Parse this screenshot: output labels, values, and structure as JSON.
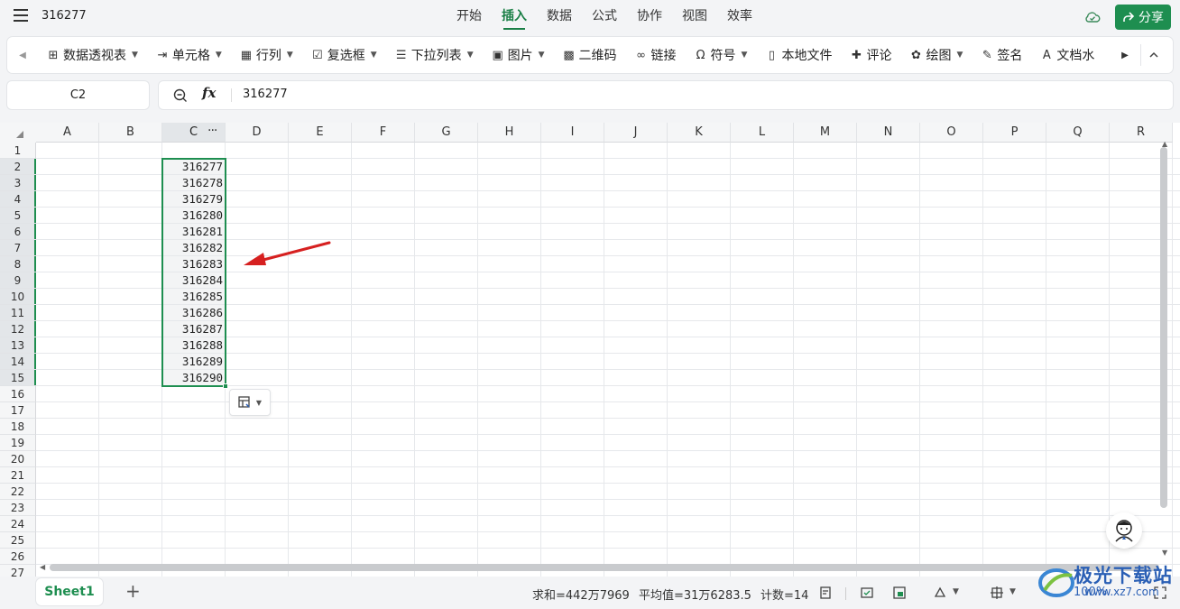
{
  "title_bar": {
    "doc_title": "316277",
    "tabs": [
      {
        "label": "开始",
        "active": false
      },
      {
        "label": "插入",
        "active": true
      },
      {
        "label": "数据",
        "active": false
      },
      {
        "label": "公式",
        "active": false
      },
      {
        "label": "协作",
        "active": false
      },
      {
        "label": "视图",
        "active": false
      },
      {
        "label": "效率",
        "active": false
      }
    ],
    "share_label": "分享"
  },
  "ribbon": {
    "items": [
      {
        "label": "数据透视表",
        "icon": "pivot-table-icon",
        "dropdown": true
      },
      {
        "label": "单元格",
        "icon": "cell-icon",
        "dropdown": true
      },
      {
        "label": "行列",
        "icon": "row-col-icon",
        "dropdown": true
      },
      {
        "label": "复选框",
        "icon": "checkbox-icon",
        "dropdown": true
      },
      {
        "label": "下拉列表",
        "icon": "dropdown-list-icon",
        "dropdown": true
      },
      {
        "label": "图片",
        "icon": "image-icon",
        "dropdown": true
      },
      {
        "label": "二维码",
        "icon": "qrcode-icon",
        "dropdown": false
      },
      {
        "label": "链接",
        "icon": "link-icon",
        "dropdown": false
      },
      {
        "label": "符号",
        "icon": "omega-icon",
        "dropdown": true
      },
      {
        "label": "本地文件",
        "icon": "file-icon",
        "dropdown": false
      },
      {
        "label": "评论",
        "icon": "comment-icon",
        "dropdown": false
      },
      {
        "label": "绘图",
        "icon": "shapes-icon",
        "dropdown": true
      },
      {
        "label": "签名",
        "icon": "signature-icon",
        "dropdown": false
      },
      {
        "label": "文档水",
        "icon": "watermark-icon",
        "dropdown": false
      }
    ]
  },
  "formula_bar": {
    "cell_ref": "C2",
    "fx_label": "fx",
    "value": "316277"
  },
  "grid": {
    "columns": [
      "A",
      "B",
      "C",
      "D",
      "E",
      "F",
      "G",
      "H",
      "I",
      "J",
      "K",
      "L",
      "M",
      "N",
      "O",
      "P",
      "Q",
      "R"
    ],
    "selected_column": "C",
    "rows": [
      "1",
      "2",
      "3",
      "4",
      "5",
      "6",
      "7",
      "8",
      "9",
      "10",
      "11",
      "12",
      "13",
      "14",
      "15",
      "16",
      "17",
      "18",
      "19",
      "20",
      "21",
      "22",
      "23",
      "24",
      "25",
      "26",
      "27"
    ],
    "col_c_values": [
      "316277",
      "316278",
      "316279",
      "316280",
      "316281",
      "316282",
      "316283",
      "316284",
      "316285",
      "316286",
      "316287",
      "316288",
      "316289",
      "316290"
    ],
    "selection_range": "C2:C15"
  },
  "status_bar": {
    "sheet_name": "Sheet1",
    "sum": "求和=442万7969",
    "average": "平均值=31万6283.5",
    "count": "计数=14",
    "zoom": "100%"
  },
  "watermark": {
    "text": "极光下载站",
    "url": "www.xz7.com"
  },
  "colors": {
    "accent": "#1e8e50",
    "arrow": "#d62020"
  }
}
